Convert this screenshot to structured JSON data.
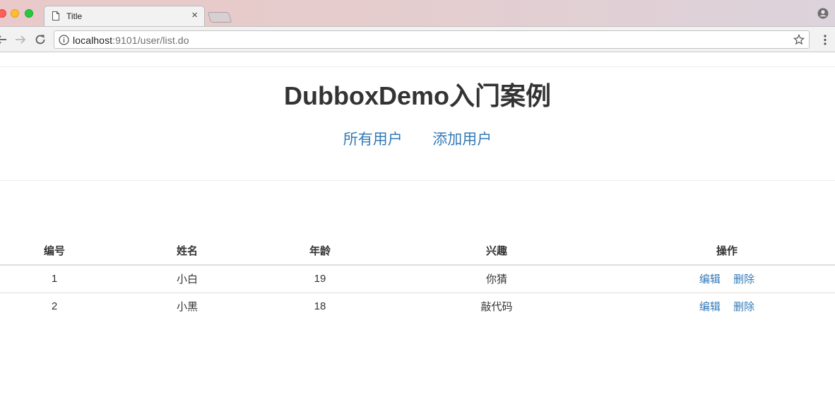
{
  "browser": {
    "tab_title": "Title",
    "tab_close": "×",
    "url_host": "localhost",
    "url_rest": ":9101/user/list.do"
  },
  "page": {
    "title": "DubboxDemo入门案例",
    "nav": [
      "所有用户",
      "添加用户"
    ]
  },
  "table": {
    "headers": [
      "编号",
      "姓名",
      "年龄",
      "兴趣",
      "操作"
    ],
    "rows": [
      {
        "id": "1",
        "name": "小白",
        "age": "19",
        "hobby": "你猜",
        "edit": "编辑",
        "delete": "删除"
      },
      {
        "id": "2",
        "name": "小黑",
        "age": "18",
        "hobby": "敲代码",
        "edit": "编辑",
        "delete": "删除"
      }
    ]
  },
  "colors": {
    "link": "#337ab7",
    "text": "#333333"
  }
}
